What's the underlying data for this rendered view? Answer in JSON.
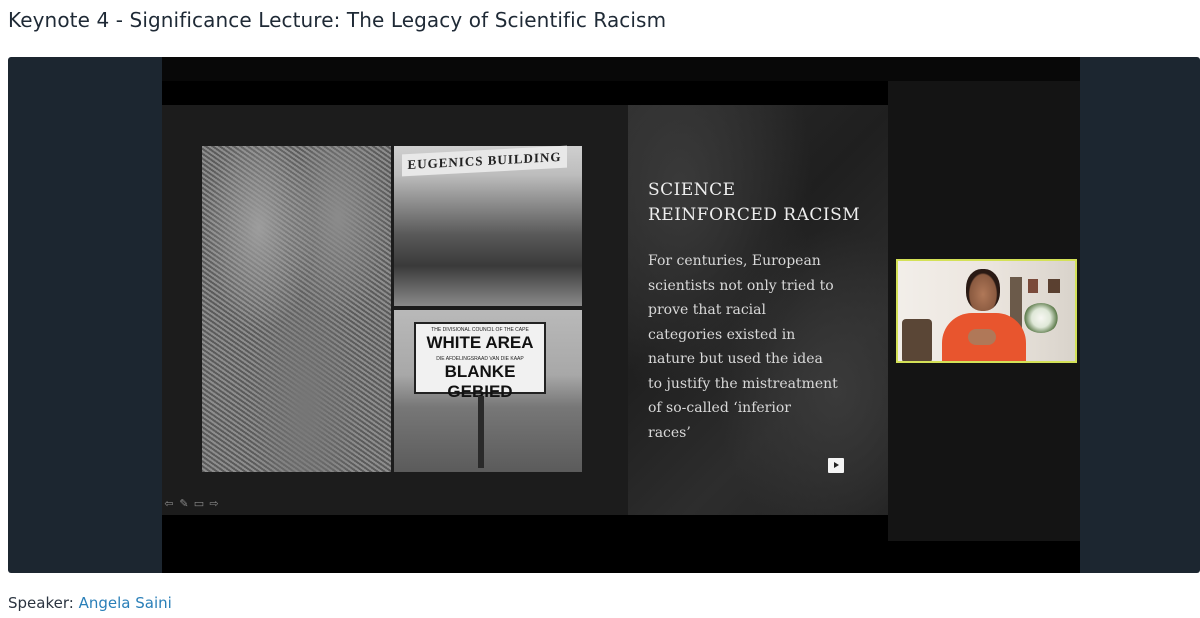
{
  "page": {
    "title": "Keynote 4 - Significance Lecture: The Legacy of Scientific Racism"
  },
  "slide": {
    "heading": "SCIENCE REINFORCED RACISM",
    "body": "For centuries, European scientists not only tried to prove that racial categories existed in nature but used the idea to justify the mistreatment of so-called ‘inferior races’",
    "images": {
      "eugenics_sign": "EUGENICS BUILDING",
      "white_area_top_small": "THE DIVISIONAL COUNCIL OF THE CAPE",
      "white_area_main": "WHITE AREA",
      "white_area_mid_small": "DIE AFDELINGSRAAD VAN DIE KAAP",
      "white_area_afrikaans": "BLANKE GEBIED"
    },
    "controls": [
      "prev-arrow-icon",
      "pen-icon",
      "menu-icon",
      "next-arrow-icon"
    ]
  },
  "speaker": {
    "label": "Speaker:",
    "name": "Angela Saini"
  },
  "colors": {
    "link": "#2a7fb8",
    "cam_border": "#d4e157",
    "player_bg": "#1c2630"
  }
}
